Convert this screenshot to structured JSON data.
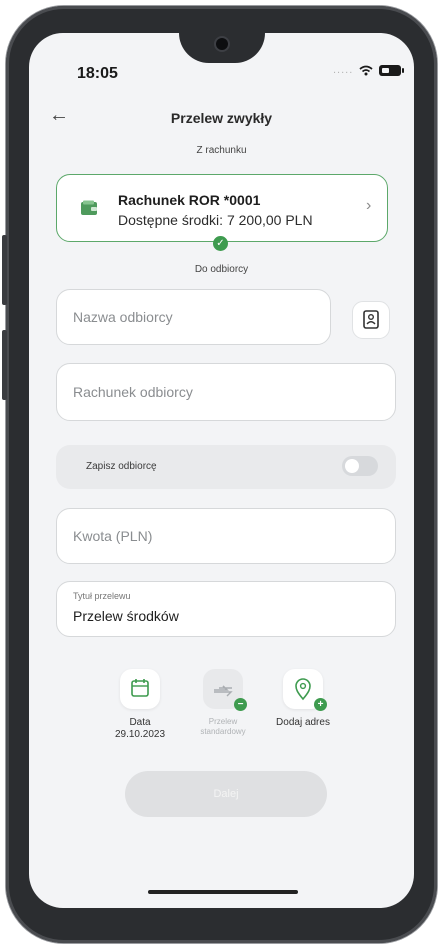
{
  "status": {
    "time": "18:05",
    "signal_dots": "....."
  },
  "header": {
    "title": "Przelew zwykły",
    "back": "←"
  },
  "from": {
    "label": "Z rachunku",
    "account_name": "Rachunek ROR *0001",
    "balance": "Dostępne środki: 7 200,00 PLN",
    "chevron": "›",
    "check": "✓"
  },
  "recipient": {
    "label": "Do odbiorcy",
    "name_placeholder": "Nazwa odbiorcy",
    "account_placeholder": "Rachunek odbiorcy"
  },
  "save_recipient": {
    "label": "Zapisz odbiorcę",
    "enabled": false
  },
  "amount": {
    "placeholder": "Kwota (PLN)"
  },
  "title_field": {
    "label": "Tytuł przelewu",
    "value": "Przelew środków"
  },
  "options": [
    {
      "icon": "calendar-icon",
      "line1": "Data",
      "line2": "29.10.2023"
    },
    {
      "icon": "transfer-icon",
      "line1": "Przelew",
      "line2": "standardowy",
      "badge": "−"
    },
    {
      "icon": "location-pin-icon",
      "line1": "Dodaj adres",
      "line2": "",
      "badge": "+"
    }
  ],
  "next_button": {
    "label": "Dalej"
  },
  "colors": {
    "accent": "#3e9b4f",
    "background": "#f3f4f6"
  }
}
